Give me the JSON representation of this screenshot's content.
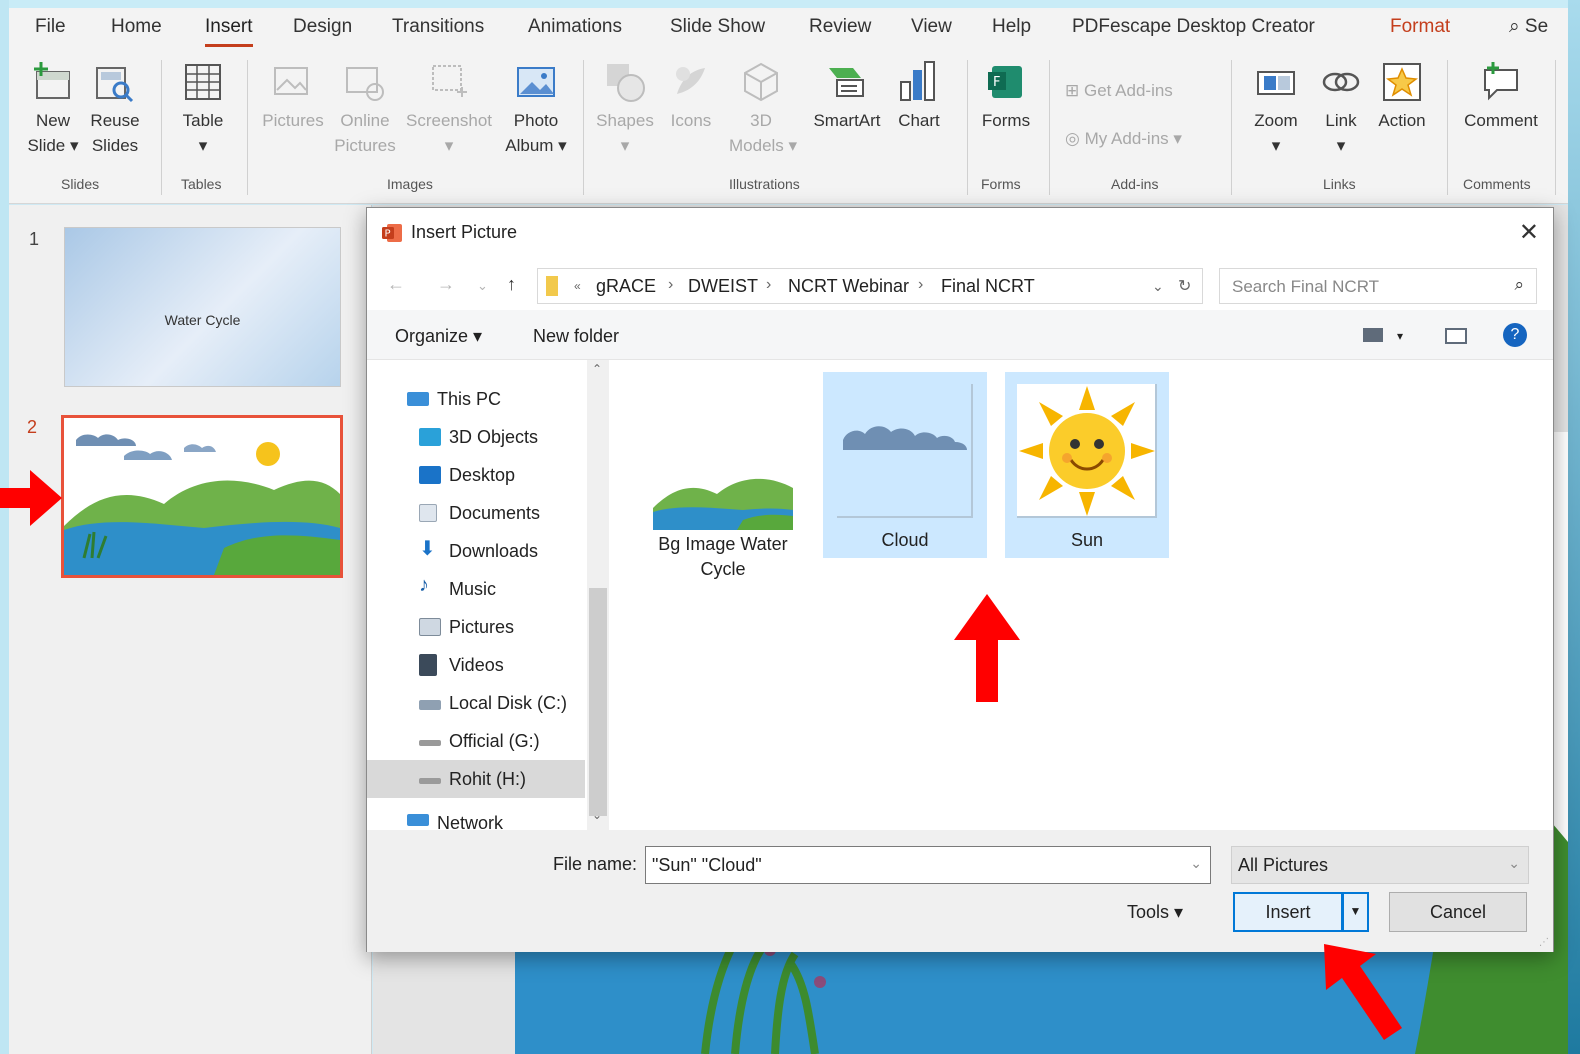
{
  "ribbon": {
    "tabs": [
      "File",
      "Home",
      "Insert",
      "Design",
      "Transitions",
      "Animations",
      "Slide Show",
      "Review",
      "View",
      "Help",
      "PDFescape Desktop Creator",
      "Format"
    ],
    "search_hint": "Se",
    "buttons": {
      "new_slide": "New",
      "new_slide_2": "Slide",
      "reuse": "Reuse",
      "reuse_2": "Slides",
      "table": "Table",
      "pictures": "Pictures",
      "online": "Online",
      "online_2": "Pictures",
      "screenshot": "Screenshot",
      "photo": "Photo",
      "photo_2": "Album",
      "shapes": "Shapes",
      "icons": "Icons",
      "models": "3D",
      "models_2": "Models",
      "smartart": "SmartArt",
      "chart": "Chart",
      "forms": "Forms",
      "get_addins": "Get Add-ins",
      "my_addins": "My Add-ins",
      "zoom": "Zoom",
      "link": "Link",
      "action": "Action",
      "comment": "Comment"
    },
    "groups": [
      "Slides",
      "Tables",
      "Images",
      "Illustrations",
      "Forms",
      "Add-ins",
      "Links",
      "Comments"
    ]
  },
  "slides_pane": {
    "slide1_number": "1",
    "slide1_title": "Water Cycle",
    "slide2_number": "2"
  },
  "dialog": {
    "title": "Insert Picture",
    "breadcrumb": [
      "gRACE",
      "DWEIST",
      "NCRT Webinar",
      "Final NCRT"
    ],
    "search_placeholder": "Search Final NCRT",
    "organize": "Organize",
    "new_folder": "New folder",
    "nav_items": [
      "This PC",
      "3D Objects",
      "Desktop",
      "Documents",
      "Downloads",
      "Music",
      "Pictures",
      "Videos",
      "Local Disk (C:)",
      "Official (G:)",
      "Rohit (H:)",
      "Network"
    ],
    "files": [
      {
        "name_line1": "Bg Image Water",
        "name_line2": "Cycle"
      },
      {
        "name_line1": "Cloud",
        "name_line2": ""
      },
      {
        "name_line1": "Sun",
        "name_line2": ""
      }
    ],
    "file_name_label": "File name:",
    "file_name_value": "\"Sun\" \"Cloud\"",
    "file_type": "All Pictures",
    "tools": "Tools",
    "insert": "Insert",
    "cancel": "Cancel"
  },
  "colors": {
    "accent": "#c43e1c",
    "selection": "#cce8ff",
    "primary_button_border": "#0078d7",
    "annotation_arrow": "#ff0000"
  }
}
